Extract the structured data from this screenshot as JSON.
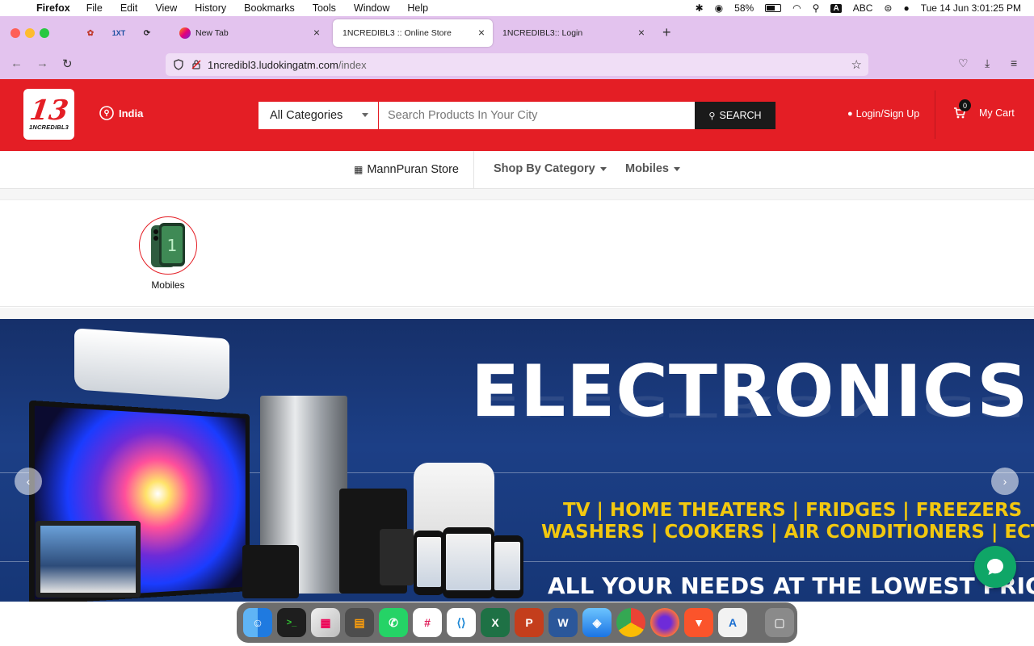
{
  "menubar": {
    "app_name": "Firefox",
    "items": [
      "File",
      "Edit",
      "View",
      "History",
      "Bookmarks",
      "Tools",
      "Window",
      "Help"
    ],
    "battery": "58%",
    "input_source": "ABC",
    "input_badge": "A",
    "datetime": "Tue 14 Jun  3:01:25 PM"
  },
  "browser": {
    "pinned_tabs": [
      "1XT"
    ],
    "tabs": [
      {
        "title": "New Tab",
        "active": false
      },
      {
        "title": "1NCREDIBL3 :: Online Store",
        "active": true
      },
      {
        "title": "1NCREDIBL3:: Login",
        "active": false
      }
    ],
    "url_host": "1ncredibl3.ludokingatm.com",
    "url_path": "/index"
  },
  "site": {
    "logo_number": "13",
    "logo_word": "1NCREDIBL3",
    "location": "India",
    "category_select": "All Categories",
    "search_placeholder": "Search Products In Your City",
    "search_button": "SEARCH",
    "login_label": "Login/Sign Up",
    "cart_count": "0",
    "cart_label": "My Cart",
    "accent_color": "#e41e25"
  },
  "subnav": {
    "store": "MannPuran Store",
    "shop_by_category": "Shop By Category",
    "mobiles": "Mobiles"
  },
  "categories": [
    {
      "label": "Mobiles"
    }
  ],
  "banner": {
    "title": "ELECTRONICS",
    "line1": "TV | HOME THEATERS | FRIDGES | FREEZERS",
    "line2": "WASHERS | COOKERS | AIR CONDITIONERS | ECT.",
    "line3": "ALL YOUR NEEDS AT THE LOWEST PRICES!",
    "prev": "‹",
    "next": "›"
  },
  "dock": [
    "finder",
    "terminal",
    "launchpad",
    "calculator",
    "whatsapp",
    "slack",
    "vscode",
    "excel",
    "powerpoint",
    "word",
    "safari",
    "chrome",
    "firefox",
    "brave",
    "ai-app",
    "trash"
  ]
}
